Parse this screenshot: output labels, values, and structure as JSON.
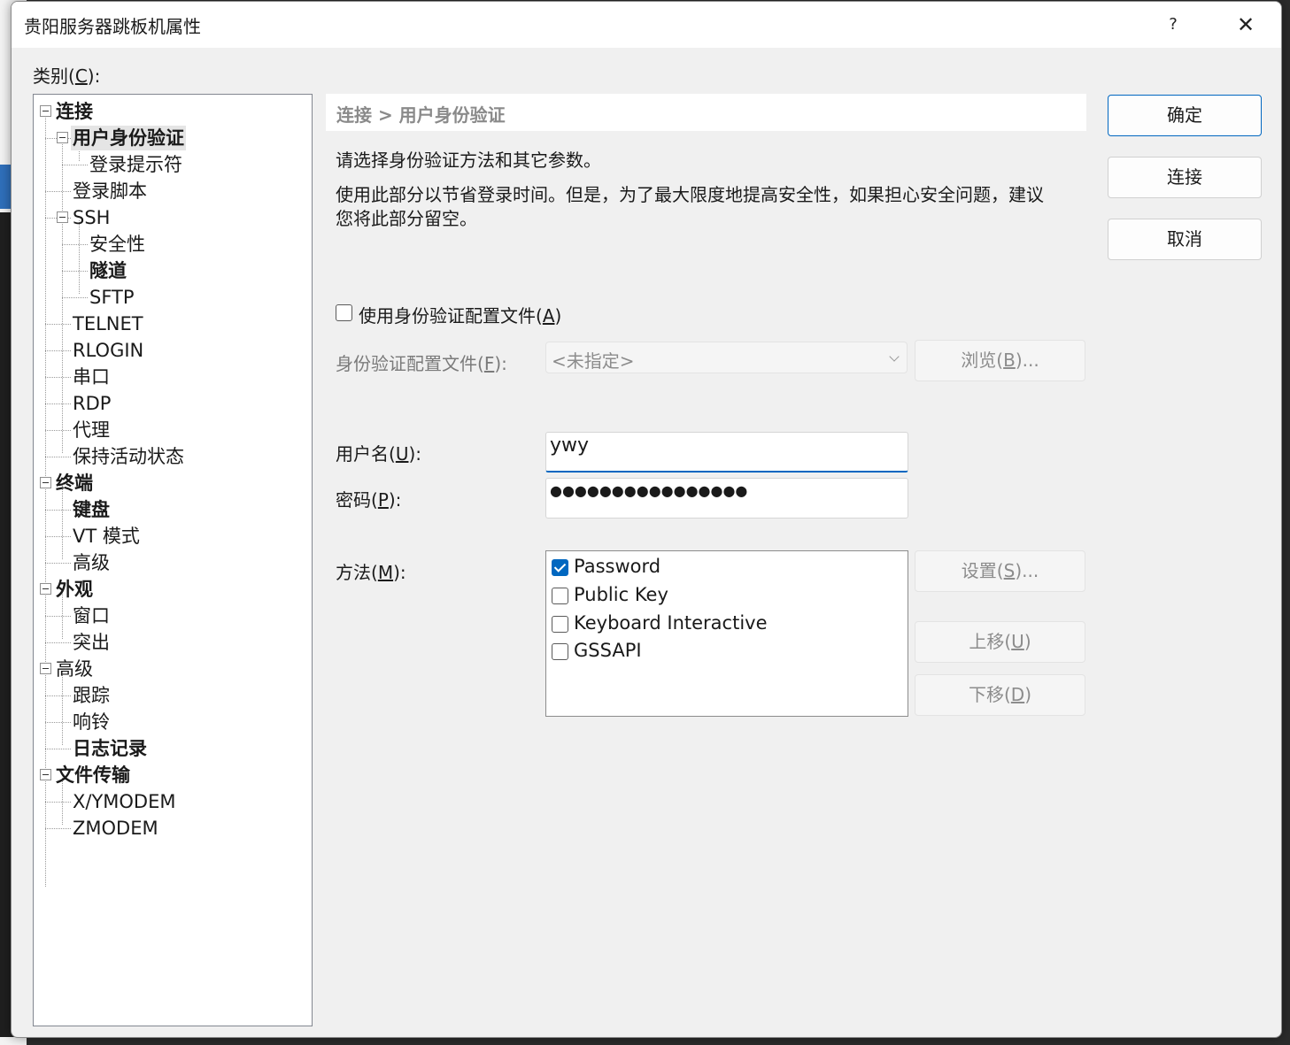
{
  "window": {
    "title": "贵阳服务器跳板机属性",
    "help_label": "?",
    "close_label": "✕"
  },
  "category_label": "类别(C):",
  "category_label_parts": {
    "pre": "类别(",
    "key": "C",
    "post": "):"
  },
  "tree": {
    "selected": "用户身份验证",
    "items": [
      {
        "label": "连接",
        "bold": true,
        "level": 0,
        "expanded": true
      },
      {
        "label": "用户身份验证",
        "bold": true,
        "level": 1,
        "expanded": true,
        "selected": true
      },
      {
        "label": "登录提示符",
        "bold": false,
        "level": 2
      },
      {
        "label": "登录脚本",
        "bold": false,
        "level": 1
      },
      {
        "label": "SSH",
        "bold": false,
        "level": 1,
        "expanded": true
      },
      {
        "label": "安全性",
        "bold": false,
        "level": 2
      },
      {
        "label": "隧道",
        "bold": true,
        "level": 2
      },
      {
        "label": "SFTP",
        "bold": false,
        "level": 2
      },
      {
        "label": "TELNET",
        "bold": false,
        "level": 1
      },
      {
        "label": "RLOGIN",
        "bold": false,
        "level": 1
      },
      {
        "label": "串口",
        "bold": false,
        "level": 1
      },
      {
        "label": "RDP",
        "bold": false,
        "level": 1
      },
      {
        "label": "代理",
        "bold": false,
        "level": 1
      },
      {
        "label": "保持活动状态",
        "bold": false,
        "level": 1
      },
      {
        "label": "终端",
        "bold": true,
        "level": 0,
        "expanded": true
      },
      {
        "label": "键盘",
        "bold": true,
        "level": 1
      },
      {
        "label": "VT 模式",
        "bold": false,
        "level": 1
      },
      {
        "label": "高级",
        "bold": false,
        "level": 1
      },
      {
        "label": "外观",
        "bold": true,
        "level": 0,
        "expanded": true
      },
      {
        "label": "窗口",
        "bold": false,
        "level": 1
      },
      {
        "label": "突出",
        "bold": false,
        "level": 1
      },
      {
        "label": "高级",
        "bold": false,
        "level": 0,
        "expanded": true
      },
      {
        "label": "跟踪",
        "bold": false,
        "level": 1
      },
      {
        "label": "响铃",
        "bold": false,
        "level": 1
      },
      {
        "label": "日志记录",
        "bold": true,
        "level": 1
      },
      {
        "label": "文件传输",
        "bold": true,
        "level": 0,
        "expanded": true
      },
      {
        "label": "X/YMODEM",
        "bold": false,
        "level": 1
      },
      {
        "label": "ZMODEM",
        "bold": false,
        "level": 1
      }
    ]
  },
  "panel": {
    "breadcrumb": "连接 > 用户身份验证",
    "intro": "请选择身份验证方法和其它参数。",
    "note_line1": "使用此部分以节省登录时间。但是，为了最大限度地提高安全性，如果担心安全问题，建议",
    "note_line2": "您将此部分留空。",
    "use_profile": {
      "pre": "使用身份验证配置文件(",
      "key": "A",
      "post": ")",
      "checked": false
    },
    "profile": {
      "label_pre": "身份验证配置文件(",
      "label_key": "F",
      "label_post": "):",
      "value": "<未指定>",
      "browse": {
        "pre": "浏览(",
        "key": "B",
        "post": ")..."
      }
    },
    "username": {
      "label_pre": "用户名(",
      "label_key": "U",
      "label_post": "):",
      "value": "ywy"
    },
    "password": {
      "label_pre": "密码(",
      "label_key": "P",
      "label_post": "):",
      "masked": "●●●●●●●●●●●●●●●●"
    },
    "method": {
      "label_pre": "方法(",
      "label_key": "M",
      "label_post": "):",
      "items": [
        {
          "label": "Password",
          "checked": true
        },
        {
          "label": "Public Key",
          "checked": false
        },
        {
          "label": "Keyboard Interactive",
          "checked": false
        },
        {
          "label": "GSSAPI",
          "checked": false
        }
      ],
      "settings": {
        "pre": "设置(",
        "key": "S",
        "post": ")..."
      },
      "move_up": {
        "pre": "上移(",
        "key": "U",
        "post": ")"
      },
      "move_down": {
        "pre": "下移(",
        "key": "D",
        "post": ")"
      }
    }
  },
  "buttons": {
    "ok": "确定",
    "connect": "连接",
    "cancel": "取消"
  },
  "colors": {
    "accent": "#0067c0",
    "dialog_bg": "#f0f0f0"
  }
}
